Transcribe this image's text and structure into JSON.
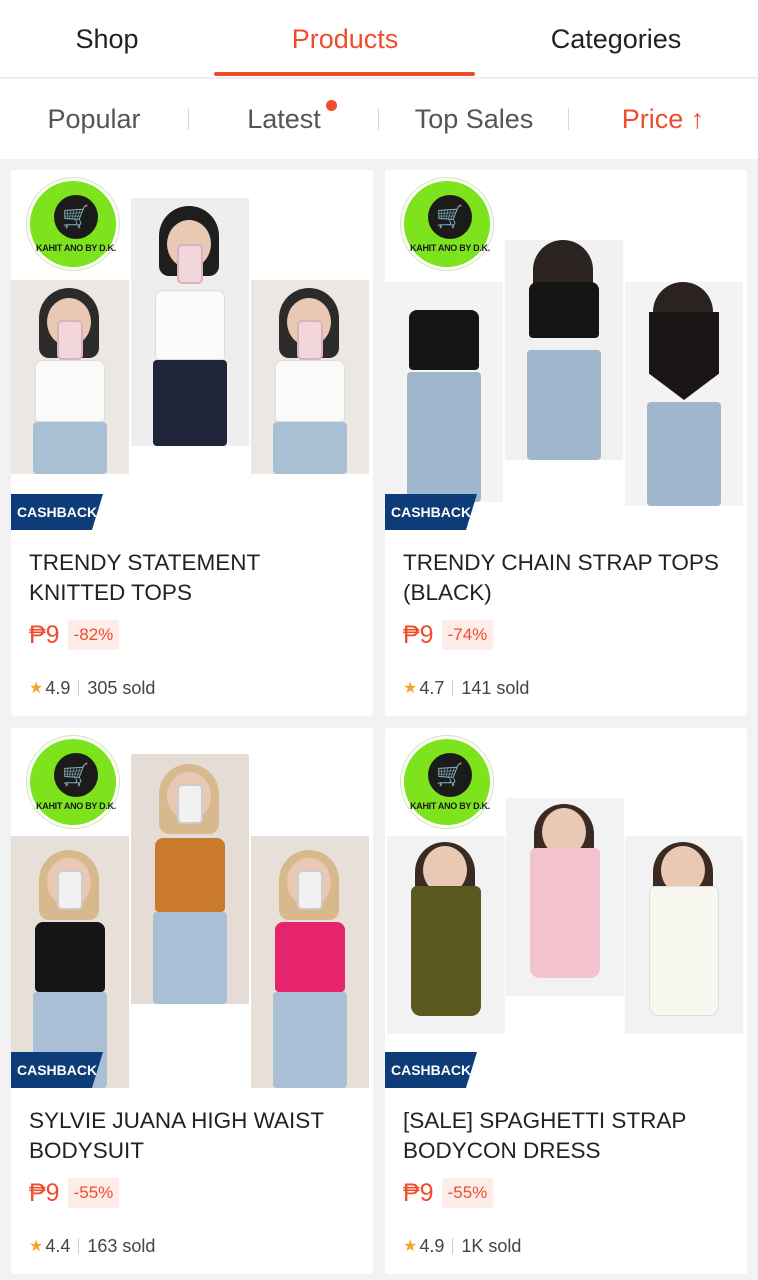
{
  "tabs": [
    {
      "label": "Shop",
      "active": false
    },
    {
      "label": "Products",
      "active": true
    },
    {
      "label": "Categories",
      "active": false
    }
  ],
  "sort": {
    "popular": "Popular",
    "latest": "Latest",
    "top_sales": "Top Sales",
    "price": "Price ↑"
  },
  "colors": {
    "accent": "#ee4d2d",
    "cashback": "#0d3c78",
    "logo": "#7de31d"
  },
  "shop_logo": {
    "text": "KAHIT ANO BY D.K.",
    "icon": "shopping-cart-icon"
  },
  "products": [
    {
      "badge": "CASHBACK",
      "title": "TRENDY STATEMENT KNITTED TOPS",
      "price": "₱9",
      "discount": "-82%",
      "rating": "4.9",
      "sold": "305 sold"
    },
    {
      "badge": "CASHBACK",
      "title": "TRENDY CHAIN STRAP TOPS (BLACK)",
      "price": "₱9",
      "discount": "-74%",
      "rating": "4.7",
      "sold": "141 sold"
    },
    {
      "badge": "CASHBACK",
      "title": "SYLVIE JUANA HIGH WAIST BODYSUIT",
      "price": "₱9",
      "discount": "-55%",
      "rating": "4.4",
      "sold": "163 sold"
    },
    {
      "badge": "CASHBACK",
      "title": "[SALE] SPAGHETTI STRAP BODYCON DRESS",
      "price": "₱9",
      "discount": "-55%",
      "rating": "4.9",
      "sold": "1K sold"
    }
  ]
}
